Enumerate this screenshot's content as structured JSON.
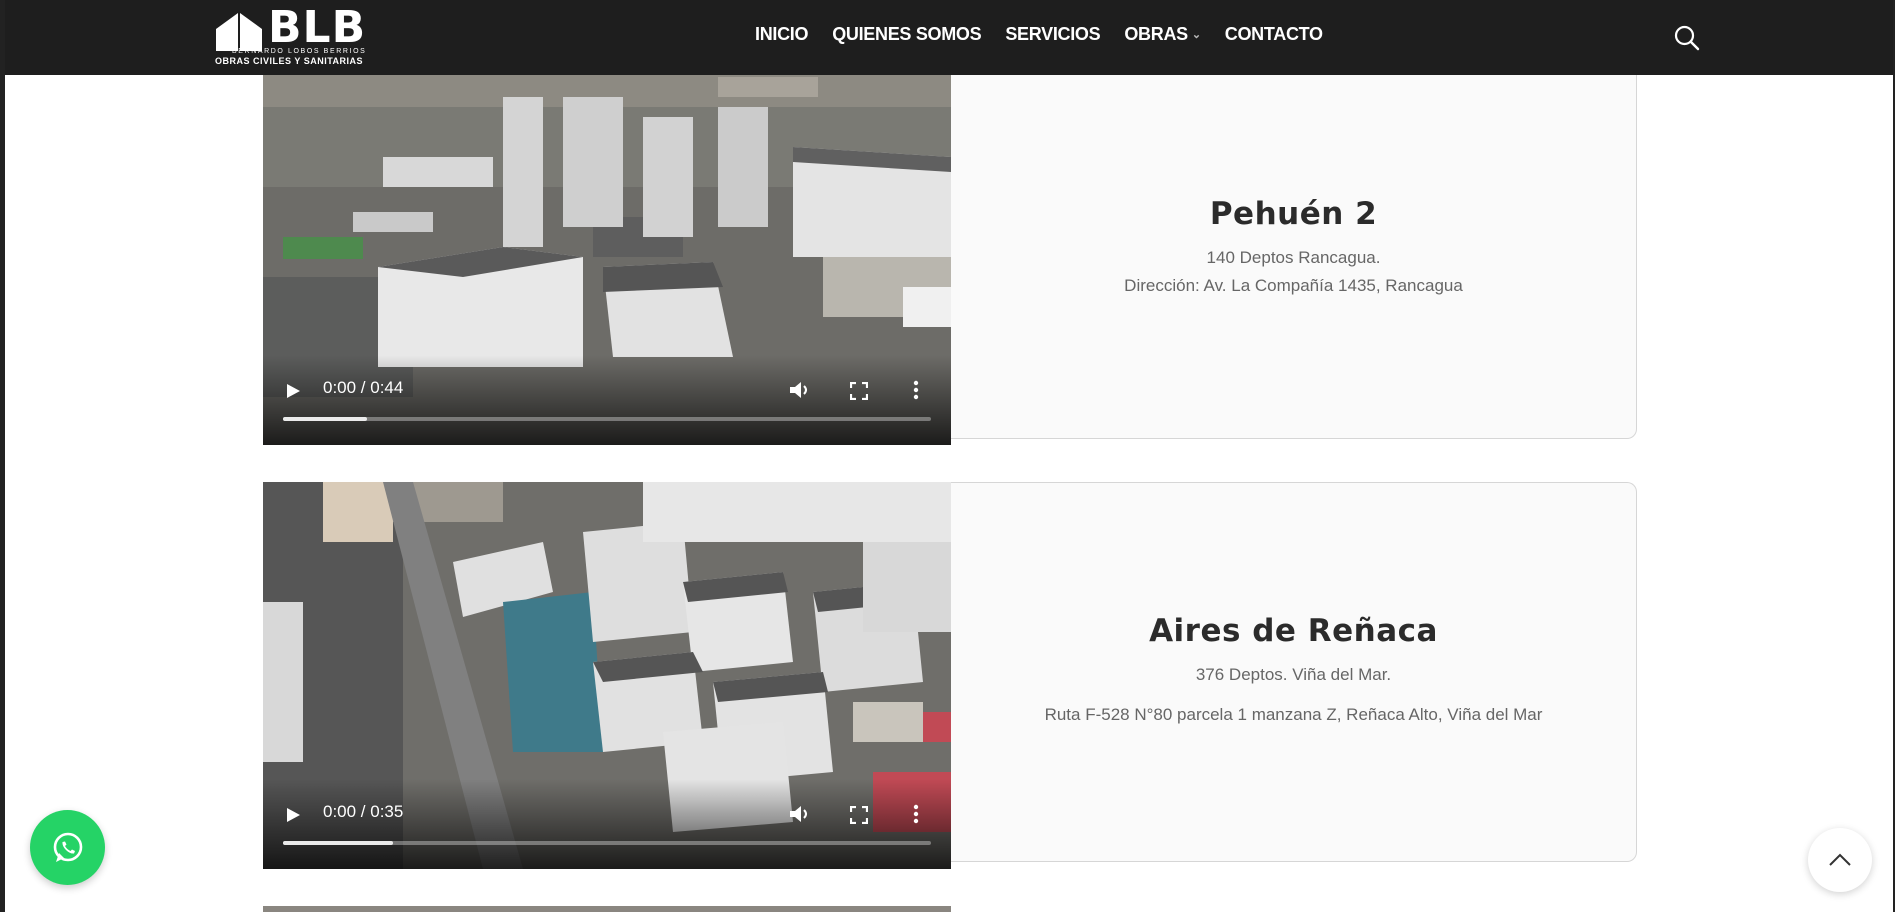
{
  "brand": {
    "logo_text": "BLB",
    "sub_name": "BERNARDO LOBOS BERRIOS",
    "sub_tagline": "OBRAS CIVILES Y SANITARIAS"
  },
  "nav": {
    "items": [
      {
        "label": "INICIO"
      },
      {
        "label": "QUIENES SOMOS"
      },
      {
        "label": "SERVICIOS"
      },
      {
        "label": "OBRAS",
        "has_dropdown": true
      },
      {
        "label": "CONTACTO"
      }
    ],
    "search_icon": "search-icon"
  },
  "projects": [
    {
      "title": "Pehuén 2",
      "line1": "140 Deptos Rancagua.",
      "line2": "Dirección: Av. La Compañía 1435, Rancagua",
      "video_time": "0:00 / 0:44",
      "buffered_fraction": 0.13
    },
    {
      "title": "Aires de Reñaca",
      "line1": "376 Deptos. Viña del Mar.",
      "line2": "Ruta F-528 N°80 parcela  1 manzana Z, Reñaca Alto, Viña del Mar",
      "video_time": "0:00 / 0:35",
      "buffered_fraction": 0.17
    }
  ],
  "floating": {
    "whatsapp_icon": "whatsapp-icon",
    "scroll_top_icon": "chevron-up-icon"
  },
  "colors": {
    "header_bg": "#1e1e1e",
    "whatsapp_green": "#25d366",
    "card_bg": "#fafafa"
  }
}
